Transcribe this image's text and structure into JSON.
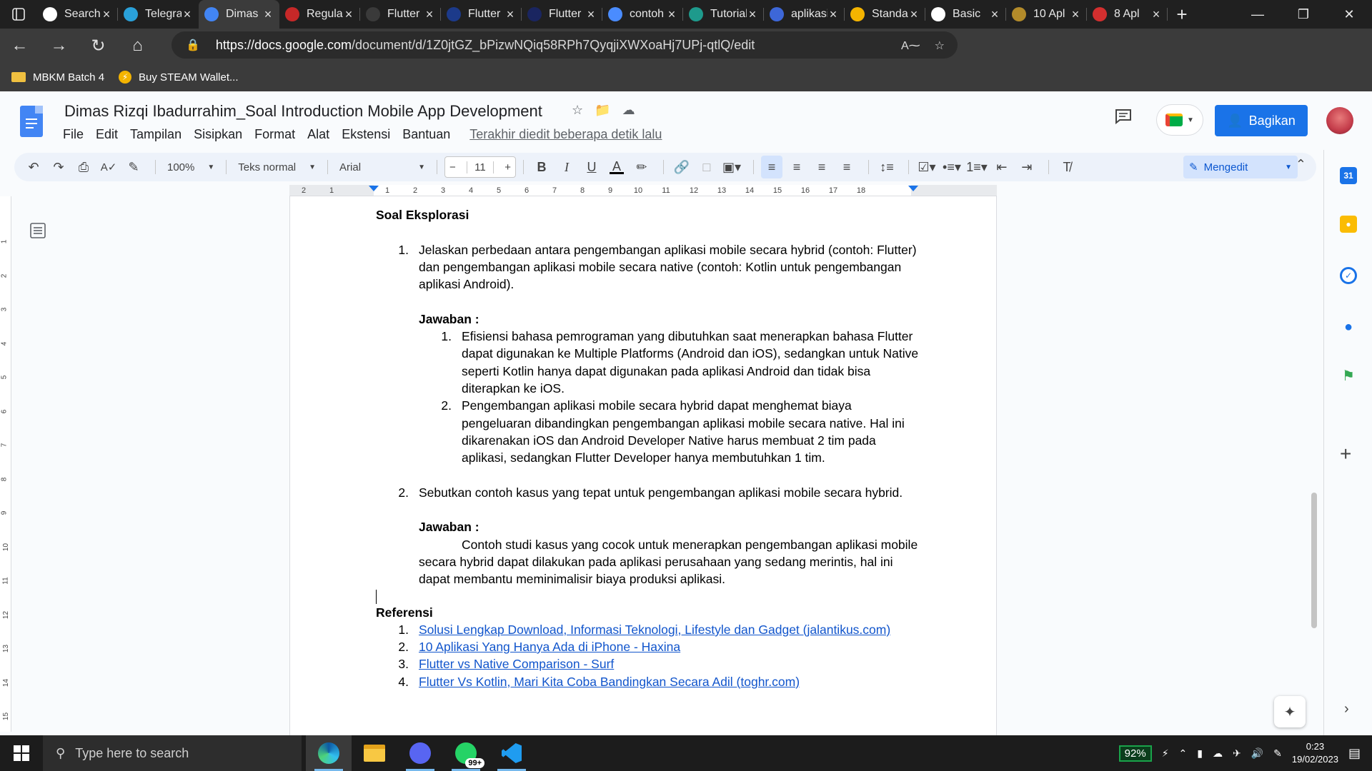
{
  "browser": {
    "tabs": [
      {
        "label": "Search",
        "icon": "github-icon",
        "color": "#ffffff"
      },
      {
        "label": "Telegram",
        "icon": "telegram-icon",
        "color": "#2aa1da"
      },
      {
        "label": "Dimas",
        "icon": "docs-icon",
        "color": "#4285f4",
        "active": true
      },
      {
        "label": "Regular",
        "icon": "app-icon",
        "color": "#c62828"
      },
      {
        "label": "Flutter",
        "icon": "flutter-icon",
        "color": "#3a3a3a"
      },
      {
        "label": "Flutter",
        "icon": "flutter-icon",
        "color": "#1c3a8a"
      },
      {
        "label": "Flutter",
        "icon": "flutter-icon",
        "color": "#1a2560"
      },
      {
        "label": "contoh",
        "icon": "search-icon",
        "color": "#4a8cff"
      },
      {
        "label": "Tutorial",
        "icon": "tutorial-icon",
        "color": "#1e9a8c"
      },
      {
        "label": "aplikasi",
        "icon": "app-icon",
        "color": "#3d67d8"
      },
      {
        "label": "Standar",
        "icon": "slides-icon",
        "color": "#f4b400"
      },
      {
        "label": "Basic",
        "icon": "github-icon",
        "color": "#ffffff"
      },
      {
        "label": "10 Apl",
        "icon": "coin-icon",
        "color": "#b38b2a"
      },
      {
        "label": "8 Apl",
        "icon": "chevron-icon",
        "color": "#d32f2f"
      }
    ],
    "url_domain": "https://docs.google.com",
    "url_path": "/document/d/1Z0jtGZ_bPizwNQiq58RPh7QyqjiXWXoaHj7UPj-qtlQ/edit",
    "bookmarks": [
      {
        "label": "MBKM Batch 4"
      },
      {
        "label": "Buy STEAM Wallet..."
      }
    ]
  },
  "docs": {
    "title": "Dimas Rizqi Ibadurrahim_Soal Introduction Mobile App Development",
    "menu": [
      "File",
      "Edit",
      "Tampilan",
      "Sisipkan",
      "Format",
      "Alat",
      "Ekstensi",
      "Bantuan"
    ],
    "last_edit": "Terakhir diedit beberapa detik lalu",
    "share_label": "Bagikan",
    "zoom": "100%",
    "style": "Teks normal",
    "font": "Arial",
    "font_size": "11",
    "mode": "Mengedit"
  },
  "ruler": [
    "2",
    "1",
    "1",
    "2",
    "3",
    "4",
    "5",
    "6",
    "7",
    "8",
    "9",
    "10",
    "11",
    "12",
    "13",
    "14",
    "15",
    "16",
    "17",
    "18"
  ],
  "vruler": [
    "1",
    "2",
    "3",
    "4",
    "5",
    "6",
    "7",
    "8",
    "9",
    "10",
    "11",
    "12",
    "13",
    "14",
    "15"
  ],
  "document": {
    "heading": "Soal Eksplorasi",
    "q1_num": "1.",
    "q1": "Jelaskan perbedaan antara pengembangan aplikasi mobile secara hybrid (contoh: Flutter) dan pengembangan aplikasi mobile secara native (contoh: Kotlin untuk pengembangan aplikasi Android).",
    "answer_label": "Jawaban :",
    "a1_items": [
      {
        "num": "1.",
        "text": "Efisiensi bahasa pemrograman yang dibutuhkan saat menerapkan bahasa Flutter dapat digunakan ke Multiple Platforms (Android dan iOS), sedangkan untuk Native seperti Kotlin hanya dapat digunakan pada aplikasi Android dan tidak bisa diterapkan ke iOS."
      },
      {
        "num": "2.",
        "text": "Pengembangan aplikasi mobile secara hybrid dapat menghemat biaya pengeluaran dibandingkan pengembangan aplikasi mobile secara native. Hal ini dikarenakan iOS dan Android Developer Native harus membuat 2 tim pada aplikasi, sedangkan Flutter Developer hanya membutuhkan 1 tim."
      }
    ],
    "q2_num": "2.",
    "q2": "Sebutkan contoh kasus yang tepat untuk pengembangan aplikasi mobile secara hybrid.",
    "a2": "Contoh studi kasus yang cocok untuk menerapkan pengembangan aplikasi mobile secara hybrid dapat dilakukan pada aplikasi perusahaan yang sedang merintis, hal ini dapat membantu meminimalisir biaya produksi aplikasi.",
    "ref_heading": "Referensi",
    "references": [
      {
        "num": "1.",
        "text": "Solusi Lengkap Download, Informasi Teknologi, Lifestyle dan Gadget (jalantikus.com)"
      },
      {
        "num": "2.",
        "text": "10 Aplikasi Yang Hanya Ada di iPhone - Haxina"
      },
      {
        "num": "3.",
        "text": "Flutter vs Native Comparison - Surf"
      },
      {
        "num": "4.",
        "text": "Flutter Vs Kotlin, Mari Kita Coba Bandingkan Secara Adil (toghr.com)"
      }
    ]
  },
  "taskbar": {
    "search_placeholder": "Type here to search",
    "whatsapp_badge": "99+",
    "battery": "92%",
    "time": "0:23",
    "date": "19/02/2023"
  }
}
